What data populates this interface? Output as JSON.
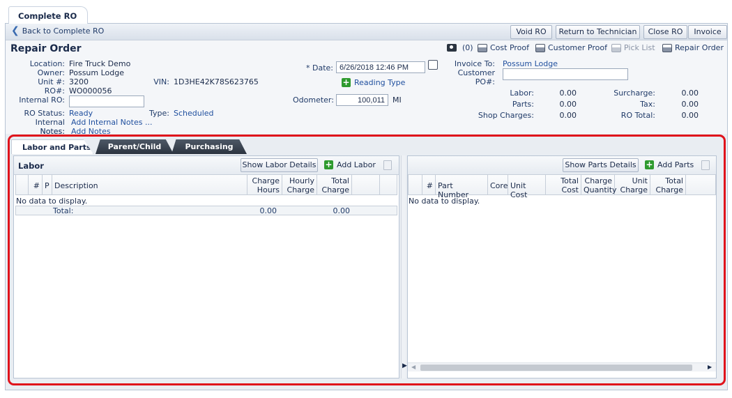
{
  "window": {
    "tab_title": "Complete RO"
  },
  "toolbar": {
    "back_label": "Back to Complete RO",
    "buttons": [
      "Void RO",
      "Return to Technician",
      "Close RO",
      "Invoice"
    ]
  },
  "header": {
    "title": "Repair Order",
    "photo_count": "(0)",
    "actions": {
      "cost_proof": "Cost Proof",
      "customer_proof": "Customer Proof",
      "pick_list": "Pick List",
      "repair_order": "Repair Order"
    }
  },
  "details": {
    "location_label": "Location:",
    "location": "Fire Truck Demo",
    "owner_label": "Owner:",
    "owner": "Possum Lodge",
    "unit_label": "Unit #:",
    "unit": "3200",
    "vin_label": "VIN:",
    "vin": "1D3HE42K78S623765",
    "ro_label": "RO#:",
    "ro": "WO000056",
    "internal_ro_label": "Internal RO:",
    "internal_ro": "",
    "status_label": "RO Status:",
    "status": "Ready",
    "type_label": "Type:",
    "type": "Scheduled",
    "internal_notes_label": "Internal Notes:",
    "internal_notes_link": "Add Internal Notes ...",
    "notes_label": "Notes:",
    "notes_link": "Add Notes",
    "date_label": "* Date:",
    "date": "6/26/2018 12:46 PM",
    "reading_type": "Reading Type",
    "odometer_label": "Odometer:",
    "odometer": "100,011",
    "odometer_unit": "MI",
    "invoice_to_label": "Invoice To:",
    "invoice_to": "Possum Lodge",
    "customer_po_label": "Customer PO#:",
    "customer_po": ""
  },
  "totals": {
    "labor_label": "Labor:",
    "labor": "0.00",
    "parts_label": "Parts:",
    "parts": "0.00",
    "shop_label": "Shop Charges:",
    "shop": "0.00",
    "surcharge_label": "Surcharge:",
    "surcharge": "0.00",
    "tax_label": "Tax:",
    "tax": "0.00",
    "ro_total_label": "RO Total:",
    "ro_total": "0.00"
  },
  "tabs": [
    "Labor and Parts",
    "Parent/Child",
    "Purchasing"
  ],
  "labor": {
    "title": "Labor",
    "show_details": "Show Labor Details",
    "add": "Add Labor",
    "columns": [
      "#",
      "P",
      "Description",
      "Charge Hours",
      "Hourly Charge",
      "Total Charge"
    ],
    "no_data": "No data to display.",
    "total_label": "Total:",
    "total_hours": "0.00",
    "total_charge": "0.00"
  },
  "parts": {
    "show_details": "Show Parts Details",
    "add": "Add Parts",
    "columns": [
      "#",
      "Part Number",
      "Core",
      "Unit Cost",
      "Total Cost",
      "Charge Quantity",
      "Unit Charge",
      "Total Charge"
    ],
    "no_data": "No data to display."
  },
  "colors": {
    "highlight": "#e0121b",
    "accent": "#1f3a68",
    "add_green": "#2e9a2e"
  }
}
